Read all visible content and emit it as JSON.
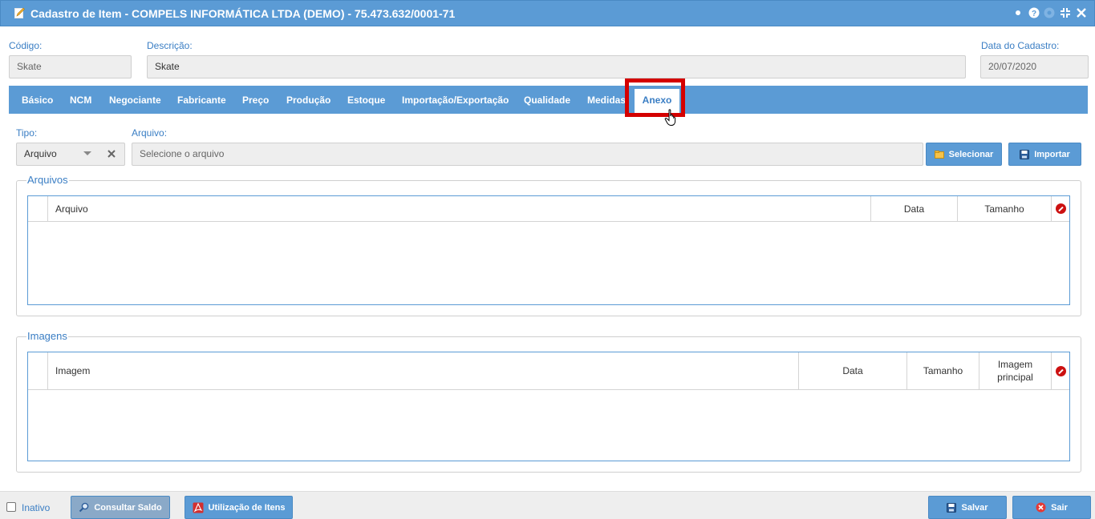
{
  "window": {
    "title": "Cadastro de Item - COMPELS INFORMÁTICA LTDA (DEMO) - 75.473.632/0001-71",
    "controls": [
      "minimize-dot",
      "help",
      "settings",
      "compress",
      "close"
    ],
    "help_label": "?",
    "close_label": "✕"
  },
  "header": {
    "codigo_label": "Código:",
    "codigo_value": "Skate",
    "descricao_label": "Descrição:",
    "descricao_value": "Skate",
    "data_label": "Data do Cadastro:",
    "data_value": "20/07/2020"
  },
  "tabs": [
    {
      "label": "Básico"
    },
    {
      "label": "NCM"
    },
    {
      "label": "Negociante"
    },
    {
      "label": "Fabricante"
    },
    {
      "label": "Preço"
    },
    {
      "label": "Produção"
    },
    {
      "label": "Estoque"
    },
    {
      "label": "Importação/Exportação"
    },
    {
      "label": "Qualidade"
    },
    {
      "label": "Medidas"
    },
    {
      "label": "Anexo",
      "active": true
    }
  ],
  "anexo": {
    "tipo_label": "Tipo:",
    "tipo_value": "Arquivo",
    "arquivo_label": "Arquivo:",
    "arquivo_placeholder": "Selecione o arquivo",
    "selecionar_label": "Selecionar",
    "importar_label": "Importar"
  },
  "arquivos": {
    "legend": "Arquivos",
    "columns": [
      "Arquivo",
      "Data",
      "Tamanho"
    ],
    "rows": []
  },
  "imagens": {
    "legend": "Imagens",
    "columns": [
      "Imagem",
      "Data",
      "Tamanho",
      "Imagem principal"
    ],
    "rows": []
  },
  "footer": {
    "inativo_label": "Inativo",
    "inativo_checked": false,
    "consultar_label": "Consultar Saldo",
    "utilizacao_label": "Utilização de Itens",
    "salvar_label": "Salvar",
    "sair_label": "Sair"
  },
  "colors": {
    "accent": "#5b9bd5",
    "label": "#3a7ec4",
    "highlight": "#d40000",
    "danger": "#cc1111"
  }
}
